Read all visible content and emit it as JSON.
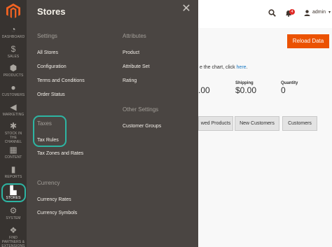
{
  "sidebar": {
    "items": [
      {
        "label": "DASHBOARD",
        "icon": "dashboard-icon",
        "glyph": "◔"
      },
      {
        "label": "SALES",
        "icon": "dollar-icon",
        "glyph": "$"
      },
      {
        "label": "PRODUCTS",
        "icon": "cube-icon",
        "glyph": "⬢"
      },
      {
        "label": "CUSTOMERS",
        "icon": "person-icon",
        "glyph": "👤"
      },
      {
        "label": "MARKETING",
        "icon": "megaphone-icon",
        "glyph": "📢"
      },
      {
        "label": "STOCK IN THE CHANNEL",
        "icon": "stock-icon",
        "glyph": "⚙"
      },
      {
        "label": "CONTENT",
        "icon": "content-icon",
        "glyph": "▦"
      },
      {
        "label": "REPORTS",
        "icon": "chart-icon",
        "glyph": "▮"
      },
      {
        "label": "STORES",
        "icon": "store-icon",
        "glyph": "🏬"
      },
      {
        "label": "SYSTEM",
        "icon": "gear-icon",
        "glyph": "⚙"
      },
      {
        "label": "FIND PARTNERS & EXTENSIONS",
        "icon": "puzzle-icon",
        "glyph": "❖"
      }
    ]
  },
  "flyout": {
    "title": "Stores",
    "settings": {
      "title": "Settings",
      "links": [
        "All Stores",
        "Configuration",
        "Terms and Conditions",
        "Order Status"
      ]
    },
    "taxes": {
      "title": "Taxes",
      "links": [
        "Tax Rules",
        "Tax Zones and Rates"
      ]
    },
    "currency": {
      "title": "Currency",
      "links": [
        "Currency Rates",
        "Currency Symbols"
      ]
    },
    "attributes": {
      "title": "Attributes",
      "links": [
        "Product",
        "Attribute Set",
        "Rating"
      ]
    },
    "other": {
      "title": "Other Settings",
      "links": [
        "Customer Groups"
      ]
    }
  },
  "header": {
    "notification_count": "4",
    "user": "admin"
  },
  "main": {
    "reload_button": "Reload Data",
    "chart_hint": "e the chart, click",
    "chart_hint_link": "here",
    "chart_hint_end": ".",
    "stats": [
      {
        "label": "",
        "value": ".00"
      },
      {
        "label": "Shipping",
        "value": "$0.00"
      },
      {
        "label": "Quantity",
        "value": "0"
      }
    ],
    "tabs": [
      "wed Products",
      "New Customers",
      "Customers"
    ]
  },
  "colors": {
    "sidebar_bg": "#373330",
    "flyout_bg": "#4a4542",
    "accent_ring": "#2db5a3",
    "reload_btn": "#eb5202"
  }
}
